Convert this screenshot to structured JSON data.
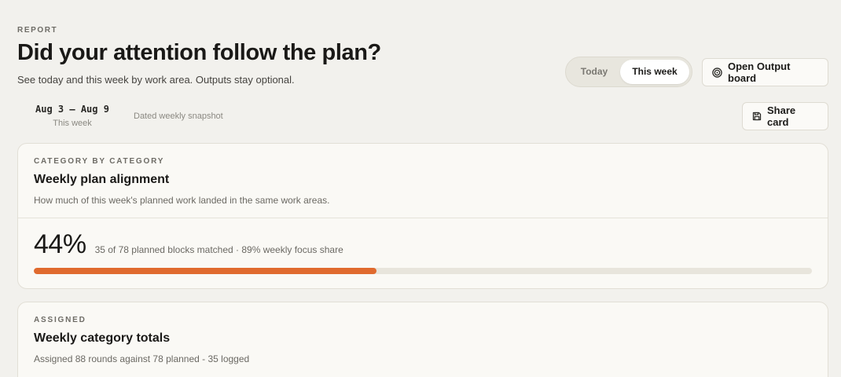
{
  "header": {
    "eyebrow": "REPORT",
    "title": "Did your attention follow the plan?",
    "subtitle": "See today and this week by work area. Outputs stay optional."
  },
  "period_toggle": {
    "options": [
      "Today",
      "This week"
    ],
    "selected": "This week"
  },
  "actions": {
    "open_output_board": "Open Output board",
    "share_card": "Share card"
  },
  "range": {
    "dates": "Aug 3 – Aug 9",
    "label": "This week",
    "snapshot_note": "Dated weekly snapshot"
  },
  "alignment_card": {
    "kicker": "CATEGORY BY CATEGORY",
    "title": "Weekly plan alignment",
    "description": "How much of this week's planned work landed in the same work areas.",
    "percent_text": "44%",
    "percent_value": 44,
    "detail": "35 of 78 planned blocks matched · 89% weekly focus share"
  },
  "totals_card": {
    "kicker": "ASSIGNED",
    "title": "Weekly category totals",
    "description": "Assigned 88 rounds against 78 planned - 35 logged"
  },
  "colors": {
    "background": "#f2f1ed",
    "card": "#faf9f5",
    "accent": "#e06a2e",
    "track": "#e8e5dc"
  },
  "icons": {
    "output_board": "target-icon",
    "share": "save-icon"
  }
}
